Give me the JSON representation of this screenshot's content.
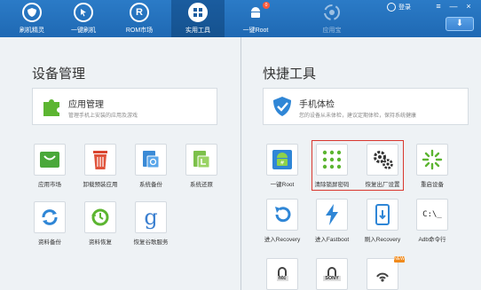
{
  "nav": {
    "items": [
      {
        "label": "刷机精灵",
        "icon": "shield-icon"
      },
      {
        "label": "一键刷机",
        "icon": "cursor-icon"
      },
      {
        "label": "ROM市场",
        "icon": "rom-icon",
        "icon_text": "R"
      },
      {
        "label": "实用工具",
        "icon": "grid-icon",
        "active": true
      },
      {
        "label": "一键Root",
        "icon": "android-icon",
        "badge": "0"
      },
      {
        "label": "应用宝",
        "icon": "app-store-icon",
        "disabled": true
      }
    ],
    "login_label": "登录",
    "window_buttons": {
      "menu": "≡",
      "minimize": "—",
      "close": "×"
    },
    "download_glyph": "⬇"
  },
  "device_management": {
    "title": "设备管理",
    "feature": {
      "title": "应用管理",
      "subtitle": "管理手机上安装的应用及游戏"
    },
    "tiles": [
      {
        "label": "应用市场",
        "icon": "market-icon"
      },
      {
        "label": "卸载预装应用",
        "icon": "trash-icon"
      },
      {
        "label": "系统备份",
        "icon": "system-backup-icon"
      },
      {
        "label": "系统还原",
        "icon": "system-restore-icon"
      },
      {
        "label": "资料备份",
        "icon": "data-backup-icon"
      },
      {
        "label": "资料恢复",
        "icon": "data-restore-icon"
      },
      {
        "label": "恢复谷歌服务",
        "icon": "google-icon",
        "glyph": "g"
      }
    ]
  },
  "quick_tools": {
    "title": "快捷工具",
    "feature": {
      "title": "手机体检",
      "subtitle": "您的设备从未体检，建议定期体检，保持系统健康"
    },
    "tiles": [
      {
        "label": "一键Root",
        "icon": "root-icon"
      },
      {
        "label": "清除锁屏密码",
        "icon": "pattern-lock-icon"
      },
      {
        "label": "恢复出厂设置",
        "icon": "gears-icon"
      },
      {
        "label": "重启设备",
        "icon": "reboot-icon"
      },
      {
        "label": "进入Recovery",
        "icon": "recovery-icon"
      },
      {
        "label": "进入Fastboot",
        "icon": "fastboot-icon"
      },
      {
        "label": "刷入Recovery",
        "icon": "flash-recovery-icon"
      },
      {
        "label": "Adb命令行",
        "icon": "terminal-icon",
        "glyph": "C:\\_"
      },
      {
        "label": "",
        "icon": "htc-unlock-icon",
        "glyph": "htc"
      },
      {
        "label": "",
        "icon": "sony-unlock-icon",
        "glyph": "SONY"
      },
      {
        "label": "",
        "icon": "wireless-icon",
        "badge": "NEW"
      }
    ]
  },
  "colors": {
    "topbar": "#2272bd",
    "accent_green": "#5cb531",
    "accent_blue": "#2f86d6",
    "highlight": "#d9382f"
  }
}
